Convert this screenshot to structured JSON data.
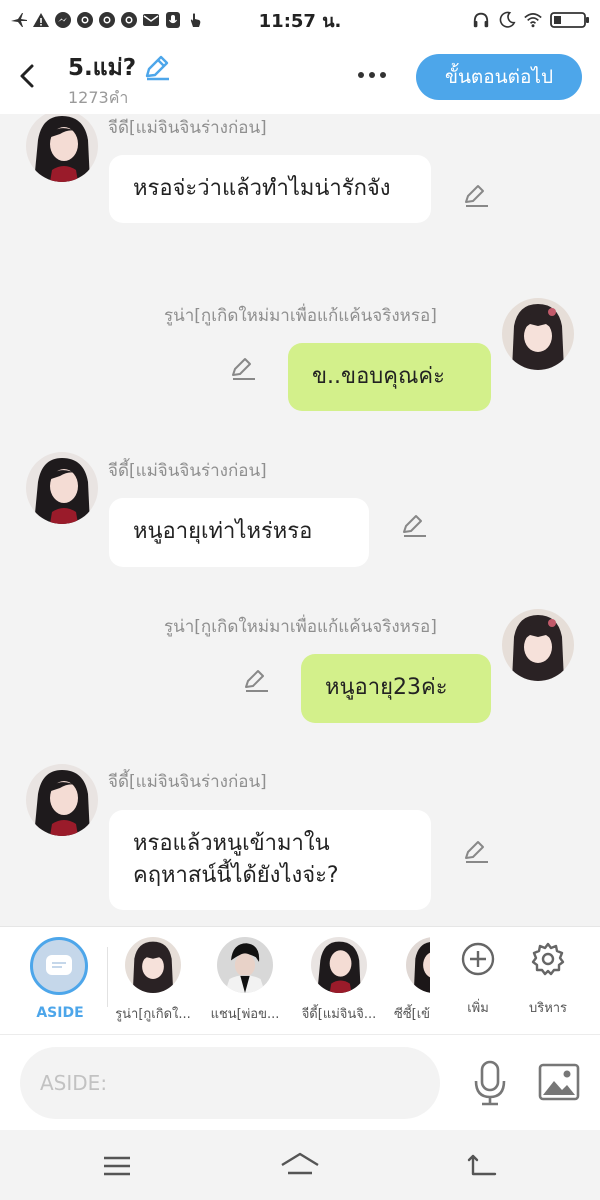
{
  "status_bar": {
    "time": "11:57 น."
  },
  "header": {
    "title": "5.แม่?",
    "word_count": "1273คำ",
    "next_label": "ขั้นตอนต่อไป"
  },
  "messages": [
    {
      "side": "left",
      "sender": "จีดี[แม่จินจินร่างก่อน]",
      "text": "หรอจ่ะว่าแล้วทำไมน่ารักจัง"
    },
    {
      "side": "right",
      "sender": "รูน่า[กูเกิดใหม่มาเพื่อแก้แค้นจริงหรอ]",
      "text": "ข..ขอบคุณค่ะ"
    },
    {
      "side": "left",
      "sender": "จีดี้[แม่จินจินร่างก่อน]",
      "text": "หนูอายุเท่าไหร่หรอ"
    },
    {
      "side": "right",
      "sender": "รูน่า[กูเกิดใหม่มาเพื่อแก้แค้นจริงหรอ]",
      "text": "หนูอายุ23ค่ะ"
    },
    {
      "side": "left",
      "sender": "จีดี้[แม่จินจินร่างก่อน]",
      "text": "หรอแล้วหนูเข้ามาในคฤหาสน์นี้ได้ยังไงจ่ะ?"
    }
  ],
  "character_bar": {
    "aside_label": "ASIDE",
    "characters": [
      {
        "name": "รูน่า[กูเกิดใ..."
      },
      {
        "name": "แชน[พ่อข..."
      },
      {
        "name": "จีดี้[แม่จินจิ..."
      },
      {
        "name": "ซีซี้[เข้"
      }
    ],
    "add_label": "เพิ่ม",
    "manage_label": "บริหาร"
  },
  "input": {
    "placeholder": "ASIDE:"
  },
  "colors": {
    "accent": "#4da6ea",
    "bubble_right": "#d3f08b",
    "bubble_left": "#ffffff",
    "background": "#f3f3f3"
  }
}
